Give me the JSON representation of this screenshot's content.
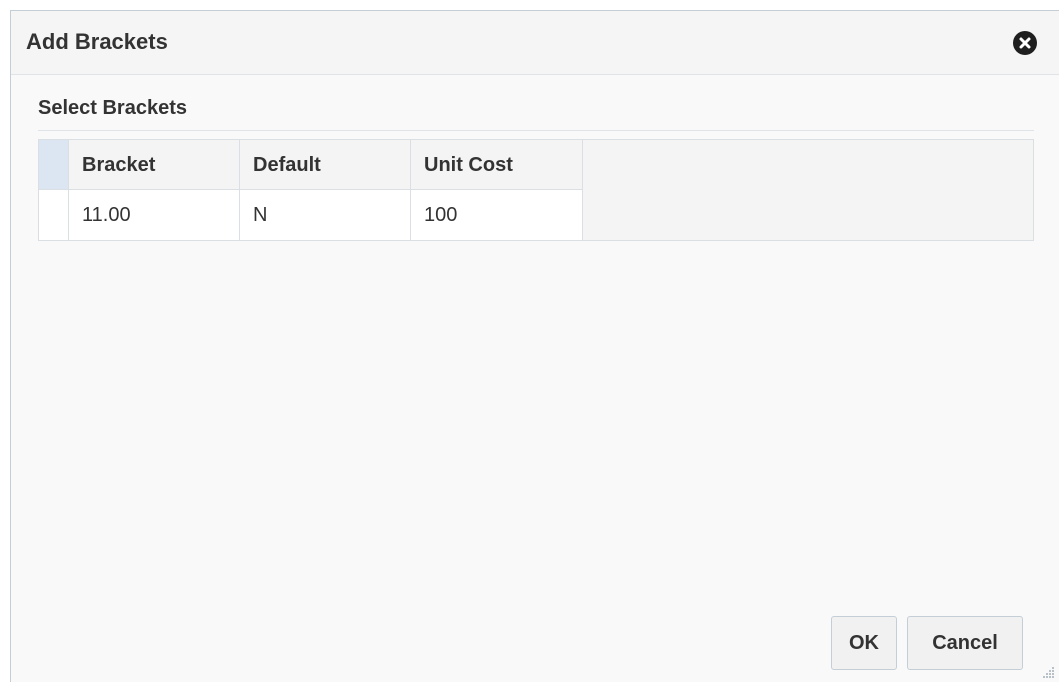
{
  "dialog": {
    "title": "Add Brackets",
    "close_icon": "close-circle-icon"
  },
  "section": {
    "title": "Select Brackets"
  },
  "table": {
    "columns": [
      "Bracket",
      "Default",
      "Unit Cost"
    ],
    "rows": [
      [
        "11.00",
        "N",
        "100"
      ]
    ]
  },
  "footer": {
    "ok_label": "OK",
    "cancel_label": "Cancel",
    "resize_icon": "resize-grip-icon"
  },
  "colors": {
    "header_selection": "#dbe6f2",
    "dialog_background": "#f9f9f9"
  }
}
